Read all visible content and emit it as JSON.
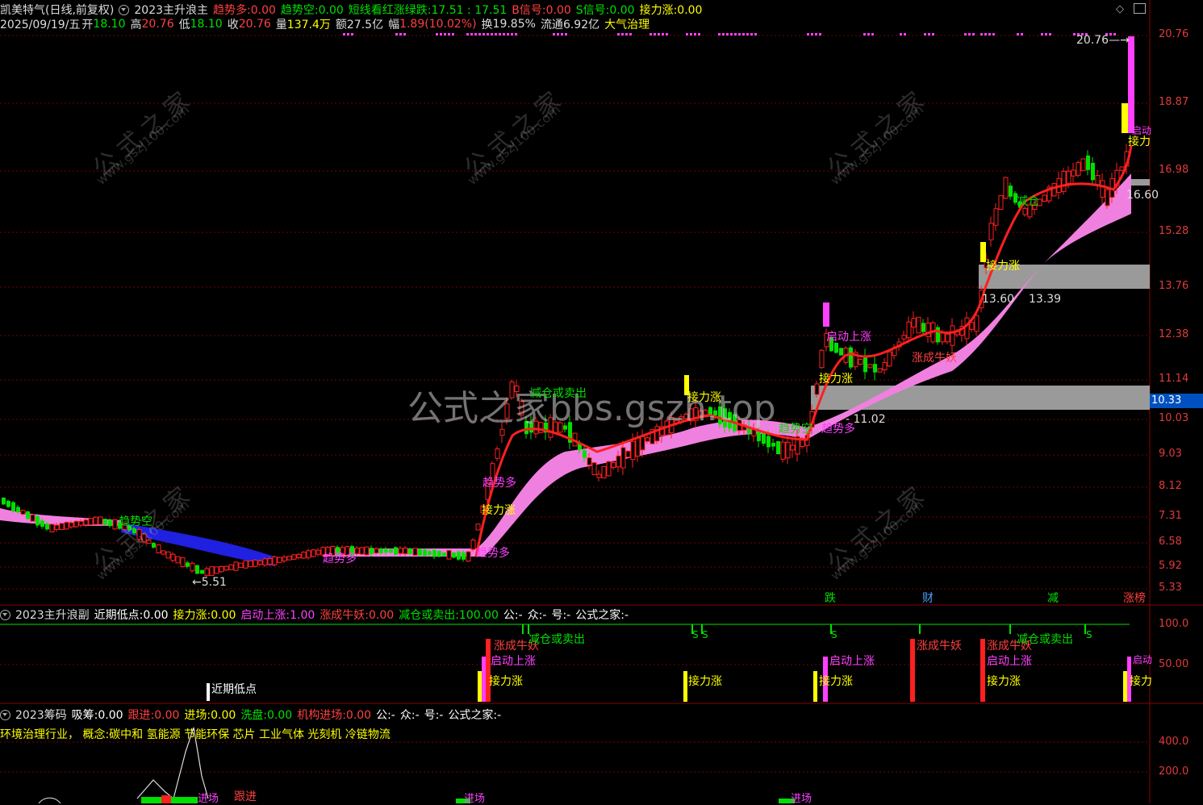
{
  "header": {
    "stock_title": "凯美特气(日线,前复权)",
    "indicator": "2023主升浪主",
    "vals": [
      {
        "k": "趋势多:",
        "v": "0.00",
        "c": "#ff4040"
      },
      {
        "k": "趋势空:",
        "v": "0.00",
        "c": "#00e000"
      },
      {
        "k": "短线看红涨绿跌:",
        "v": "17.51 : 17.51",
        "c": "#00e000"
      },
      {
        "k": "B信号:",
        "v": "0.00",
        "c": "#ff4040"
      },
      {
        "k": "S信号:",
        "v": "0.00",
        "c": "#00e000"
      },
      {
        "k": "接力涨:",
        "v": "0.00",
        "c": "#ffff00"
      }
    ],
    "date": "2025/09/19/五",
    "open_k": "开",
    "open": "18.10",
    "high_k": "高",
    "high": "20.76",
    "low_k": "低",
    "low": "18.10",
    "close_k": "收",
    "close": "20.76",
    "vol_k": "量",
    "vol": "137.4万",
    "amt_k": "额",
    "amt": "27.5亿",
    "chg_k": "幅",
    "chg": "1.89(10.02%)",
    "turn_k": "换",
    "turn": "19.85%",
    "float_k": "流通",
    "float": "6.92亿",
    "sector": "大气治理"
  },
  "price_axis": [
    "20.76",
    "18.87",
    "16.98",
    "15.28",
    "13.76",
    "12.38",
    "11.14",
    "10.03",
    "9.03",
    "8.12",
    "7.31",
    "6.58",
    "5.92",
    "5.33"
  ],
  "current_price": "10.33",
  "main_labels": {
    "peak": "20.76",
    "low1": "5.51",
    "pt1102": "11.02",
    "pt1360": "13.60",
    "pt1339": "13.39",
    "pt1660": "16.60",
    "watermark_big": "公式之家bbs.gszh.top",
    "wm_cn": "公式之家",
    "wm_url": "www.gszj100.com",
    "jieli": "接力涨",
    "qidong": "启动上涨",
    "zhangcheng": "涨成牛妖",
    "jiancang": "减仓或卖出",
    "qushi_duo": "趋势多",
    "qushi_kong": "趋势空",
    "jiancang_short": "减仓",
    "qi": "启动",
    "jieli_short": "接力"
  },
  "bottom_tags": [
    {
      "t": "跌",
      "c": "#00e000"
    },
    {
      "t": "财",
      "c": "#4aa0ff"
    },
    {
      "t": "减",
      "c": "#00e000"
    },
    {
      "t": "涨榜",
      "c": "#ff4040"
    }
  ],
  "sub1": {
    "title": "2023主升浪副",
    "vals": [
      {
        "k": "近期低点:",
        "v": "0.00",
        "c": "#ffffff"
      },
      {
        "k": "接力涨:",
        "v": "0.00",
        "c": "#ffff00"
      },
      {
        "k": "启动上涨:",
        "v": "1.00",
        "c": "#ff40ff"
      },
      {
        "k": "涨成牛妖:",
        "v": "0.00",
        "c": "#ff4040"
      },
      {
        "k": "减仓或卖出:",
        "v": "100.00",
        "c": "#00e000"
      },
      {
        "k": "公:",
        "v": "-",
        "c": "#ffffff"
      },
      {
        "k": "众:",
        "v": "-",
        "c": "#ffffff"
      },
      {
        "k": "号:",
        "v": "-",
        "c": "#ffffff"
      },
      {
        "k": "公式之家:",
        "v": "-",
        "c": "#ffffff"
      }
    ],
    "axis": [
      "100.0",
      "50.00"
    ],
    "recent_low": "近期低点",
    "s": "S"
  },
  "sub2": {
    "title": "2023筹码",
    "vals": [
      {
        "k": "吸筹:",
        "v": "0.00",
        "c": "#ffffff"
      },
      {
        "k": "跟进:",
        "v": "0.00",
        "c": "#ff4040"
      },
      {
        "k": "进场:",
        "v": "0.00",
        "c": "#ffff00"
      },
      {
        "k": "洗盘:",
        "v": "0.00",
        "c": "#00e000"
      },
      {
        "k": "机构进场:",
        "v": "0.00",
        "c": "#ff4040"
      },
      {
        "k": "公:",
        "v": "-",
        "c": "#ffffff"
      },
      {
        "k": "众:",
        "v": "-",
        "c": "#ffffff"
      },
      {
        "k": "号:",
        "v": "-",
        "c": "#ffffff"
      },
      {
        "k": "公式之家:",
        "v": "-",
        "c": "#ffffff"
      }
    ],
    "concepts": "环境治理行业， 概念:碳中和 氢能源 节能环保 芯片 工业气体 光刻机 冷链物流",
    "axis": [
      "400.0",
      "200.0"
    ],
    "gen": "跟进",
    "jin": "进场"
  }
}
